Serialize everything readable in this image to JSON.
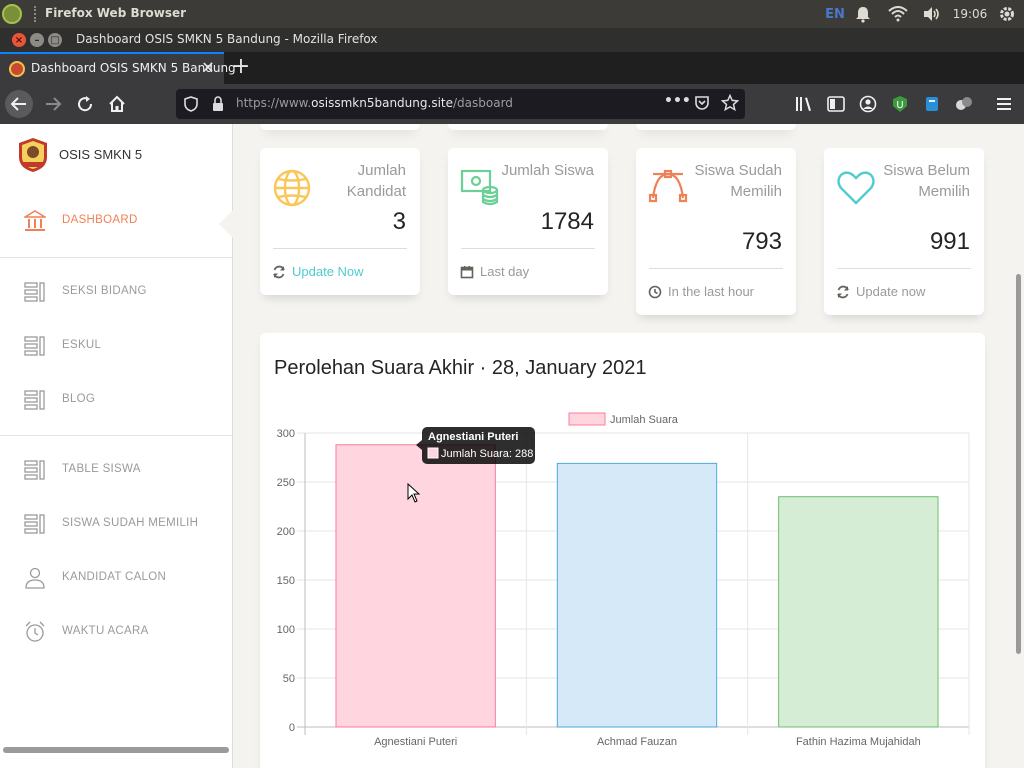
{
  "os_bar": {
    "app_name": "Firefox Web Browser",
    "lang": "EN",
    "time": "19:06"
  },
  "window": {
    "title": "Dashboard OSIS SMKN 5 Bandung - Mozilla Firefox"
  },
  "tabs": [
    {
      "label": "Dashboard OSIS SMKN 5 Bandung",
      "active": true
    }
  ],
  "urlbar": {
    "prefix": "https://www.",
    "host": "osissmkn5bandung.site",
    "path": "/dasboard"
  },
  "toolbar": {
    "extension_badge": "0"
  },
  "sidebar": {
    "brand": "OSIS SMKN 5",
    "items": [
      {
        "label": "DASHBOARD",
        "icon": "bank-icon",
        "active": true
      },
      {
        "label": "SEKSI BIDANG",
        "icon": "list-icon",
        "active": false
      },
      {
        "label": "ESKUL",
        "icon": "list-icon",
        "active": false
      },
      {
        "label": "BLOG",
        "icon": "list-icon",
        "active": false
      },
      {
        "label": "TABLE SISWA",
        "icon": "list-icon",
        "active": false
      },
      {
        "label": "SISWA SUDAH MEMILIH",
        "icon": "list-icon",
        "active": false
      },
      {
        "label": "KANDIDAT CALON",
        "icon": "user-icon",
        "active": false
      },
      {
        "label": "WAKTU ACARA",
        "icon": "alarm-clock-icon",
        "active": false
      }
    ]
  },
  "stats": [
    {
      "title": "Jumlah Kandidat",
      "value": "3",
      "footer": "Update Now",
      "footer_icon": "refresh-icon",
      "icon": "globe-icon",
      "color": "#fbc658"
    },
    {
      "title": "Jumlah Siswa",
      "value": "1784",
      "footer": "Last day",
      "footer_icon": "calendar-icon",
      "icon": "money-coins-icon",
      "color": "#6bd098"
    },
    {
      "title": "Siswa Sudah Memilih",
      "value": "793",
      "footer": "In the last hour",
      "footer_icon": "clock-icon",
      "icon": "vector-icon",
      "color": "#ef8157"
    },
    {
      "title": "Siswa Belum Memilih",
      "value": "991",
      "footer": "Update now",
      "footer_icon": "refresh-icon",
      "icon": "heart-icon",
      "color": "#51cbce"
    }
  ],
  "chart_title": "Perolehan Suara Akhir · 28, January 2021",
  "chart_data": {
    "type": "bar",
    "categories": [
      "Agnestiani Puteri",
      "Achmad Fauzan",
      "Fathin Hazima Mujahidah"
    ],
    "series": [
      {
        "name": "Jumlah Suara",
        "values": [
          288,
          269,
          235
        ]
      }
    ],
    "bar_colors": [
      "#ffd6df",
      "#d5e9f8",
      "#d5ecd5"
    ],
    "bar_borders": [
      "#ff7a97",
      "#4ea8dd",
      "#6cbf6c"
    ],
    "ylim": [
      0,
      300
    ],
    "yticks": [
      0,
      50,
      100,
      150,
      200,
      250,
      300
    ],
    "grid": true,
    "legend": "top",
    "tooltip": {
      "title": "Agnestiani Puteri",
      "label": "Jumlah Suara: 288"
    }
  }
}
